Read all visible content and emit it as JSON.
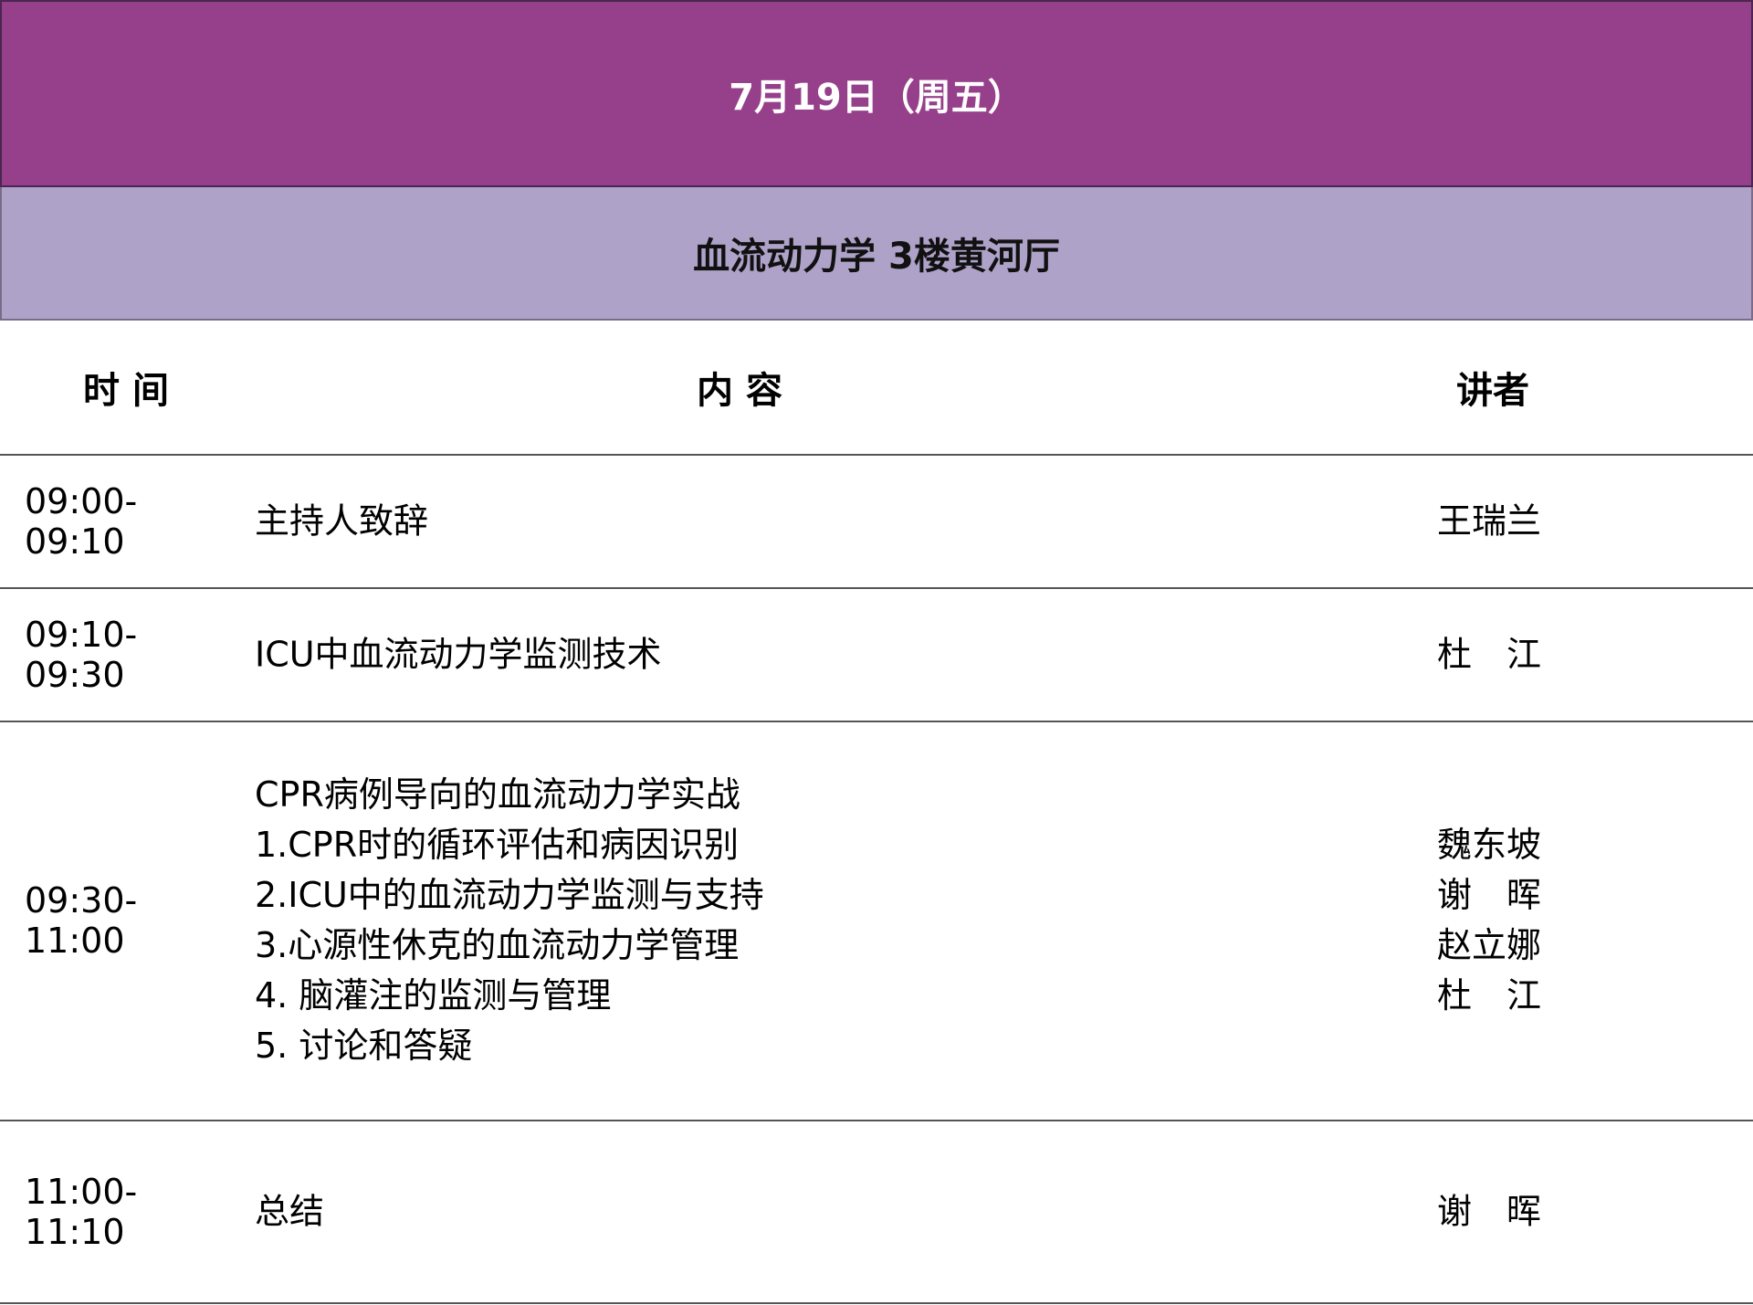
{
  "colors": {
    "date_banner_bg": "#963f8a",
    "hall_banner_bg": "#afa2c9"
  },
  "date_banner": {
    "text": "7月19日（周五）"
  },
  "hall_banner": {
    "text": "血流动力学 3楼黄河厅"
  },
  "table": {
    "headers": {
      "time": "时 间",
      "content": "内 容",
      "speaker": "讲者"
    },
    "rows": [
      {
        "time": "09:00-09:10",
        "content": [
          "主持人致辞"
        ],
        "speakers": [
          "王瑞兰"
        ]
      },
      {
        "time": "09:10-09:30",
        "content": [
          "ICU中血流动力学监测技术"
        ],
        "speakers": [
          "杜　江"
        ]
      },
      {
        "time": "09:30-11:00",
        "content": [
          "CPR病例导向的血流动力学实战",
          "1.CPR时的循环评估和病因识别",
          "2.ICU中的血流动力学监测与支持",
          "3.心源性休克的血流动力学管理",
          "4. 脑灌注的监测与管理",
          "5. 讨论和答疑"
        ],
        "speakers": [
          "魏东坡",
          "谢　晖",
          "赵立娜",
          "杜　江"
        ]
      },
      {
        "time": "11:00-11:10",
        "content": [
          "总结"
        ],
        "speakers": [
          "谢　晖"
        ]
      }
    ]
  }
}
